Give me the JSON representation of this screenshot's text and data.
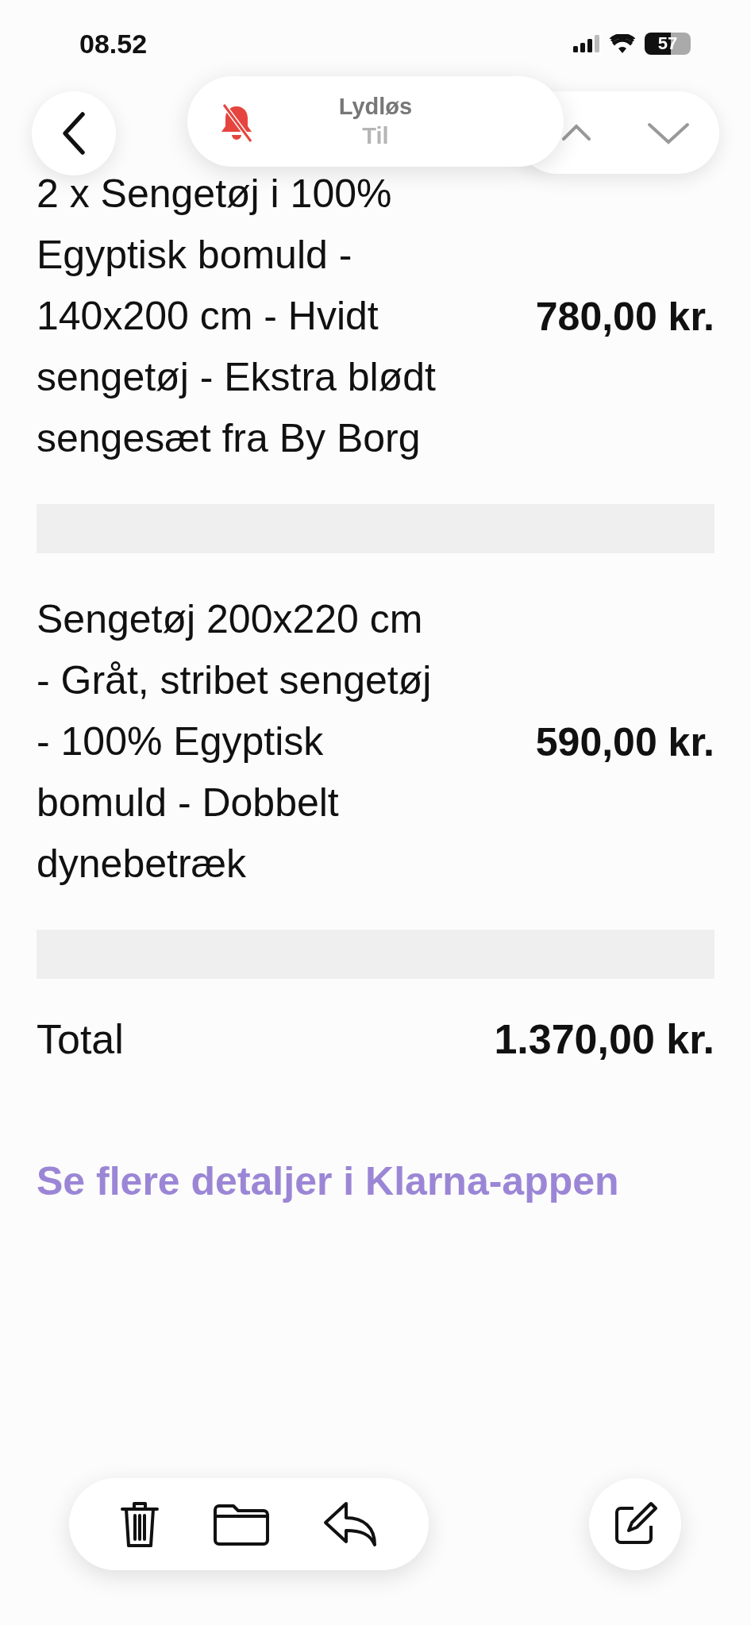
{
  "status_bar": {
    "time": "08.52",
    "battery": "57"
  },
  "silent_banner": {
    "title": "Lydløs",
    "subtitle": "Til"
  },
  "items": [
    {
      "name": "2 x Sengetøj i 100% Egyptisk bomuld - 140x200 cm - Hvidt sengetøj - Ekstra blødt sengesæt fra By Borg",
      "price": "780,00 kr."
    },
    {
      "name": "Sengetøj 200x220 cm - Gråt, stribet sengetøj - 100% Egyptisk bomuld - Dobbelt dynebetræk",
      "price": "590,00 kr."
    }
  ],
  "total": {
    "label": "Total",
    "amount": "1.370,00 kr."
  },
  "link": "Se flere detaljer i Klarna-appen"
}
